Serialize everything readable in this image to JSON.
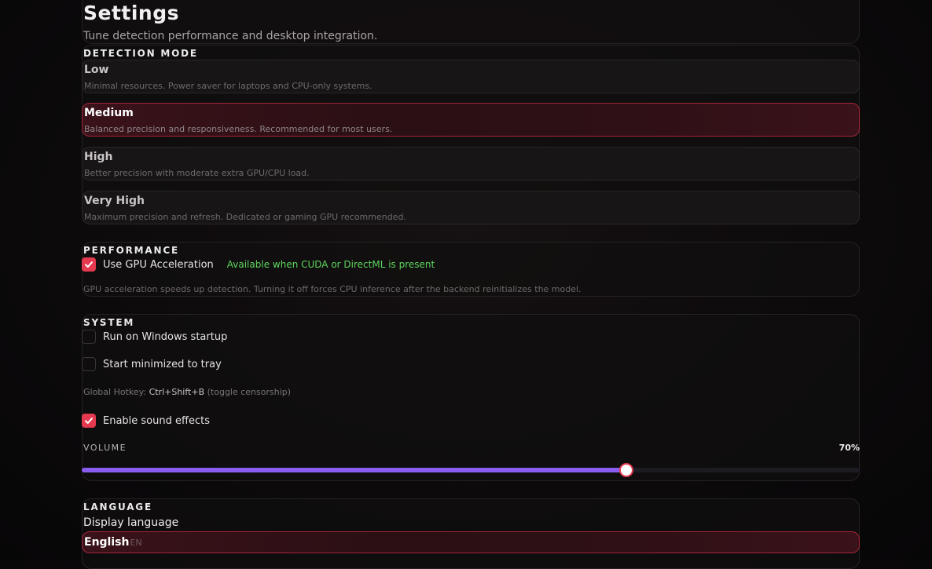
{
  "header": {
    "title": "Settings",
    "subtitle": "Tune detection performance and desktop integration."
  },
  "detection": {
    "title": "DETECTION MODE",
    "selected": "Medium",
    "modes": [
      {
        "name": "Low",
        "desc": "Minimal resources. Power saver for laptops and CPU-only systems."
      },
      {
        "name": "Medium",
        "desc": "Balanced precision and responsiveness. Recommended for most users."
      },
      {
        "name": "High",
        "desc": "Better precision with moderate extra GPU/CPU load."
      },
      {
        "name": "Very High",
        "desc": "Maximum precision and refresh. Dedicated or gaming GPU recommended."
      }
    ]
  },
  "performance": {
    "title": "PERFORMANCE",
    "gpu_label": "Use GPU Acceleration",
    "gpu_checked": true,
    "gpu_badge": "Available when CUDA or DirectML is present",
    "gpu_help": "GPU acceleration speeds up detection. Turning it off forces CPU inference after the backend reinitializes the model."
  },
  "system": {
    "title": "SYSTEM",
    "startup_label": "Run on Windows startup",
    "startup_checked": false,
    "minimized_label": "Start minimized to tray",
    "minimized_checked": false,
    "hotkey_prefix": "Global Hotkey:",
    "hotkey_keys": "Ctrl+Shift+B",
    "hotkey_suffix": "(toggle censorship)",
    "sound_label": "Enable sound effects",
    "sound_checked": true,
    "volume_label": "VOLUME",
    "volume_value": "70%",
    "volume_fraction": 0.7
  },
  "language": {
    "title": "LANGUAGE",
    "subtitle": "Display language",
    "selected_name": "English",
    "selected_code": "EN"
  },
  "colors": {
    "accent_red": "#e4394e",
    "slider_purple": "#8a5cf0",
    "badge_green": "#5fd65f"
  }
}
